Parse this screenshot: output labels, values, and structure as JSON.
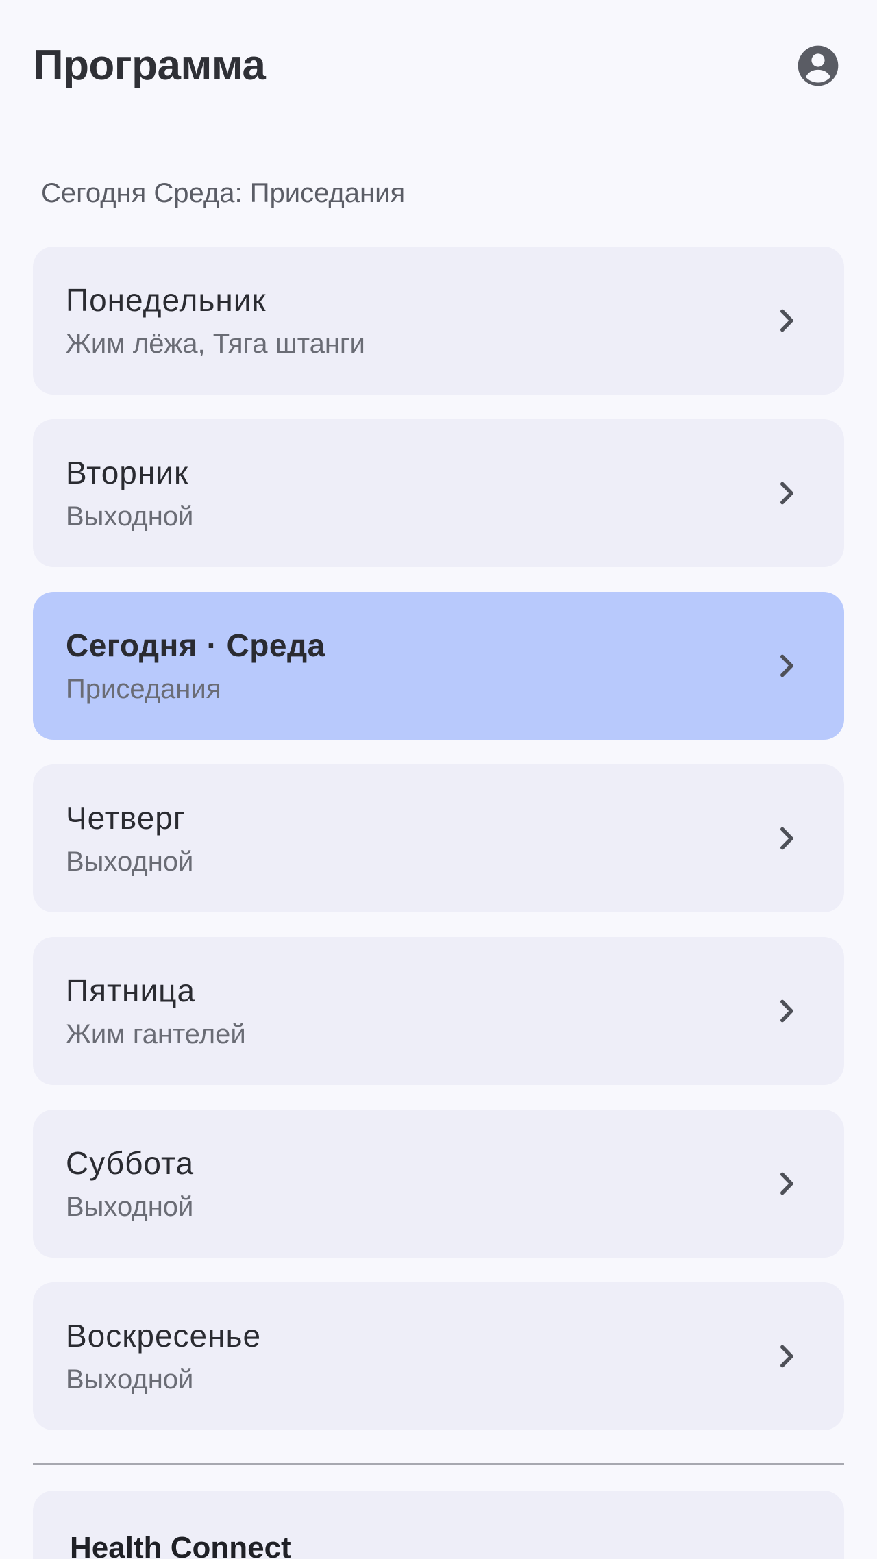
{
  "header": {
    "title": "Программа",
    "account_icon": "account-circle-icon"
  },
  "today_caption": "Сегодня Среда: Приседания",
  "days": [
    {
      "title": "Понедельник",
      "subtitle": "Жим лёжа, Тяга штанги",
      "is_today": false
    },
    {
      "title": "Вторник",
      "subtitle": "Выходной",
      "is_today": false
    },
    {
      "title": "Сегодня · Среда",
      "subtitle": "Приседания",
      "is_today": true
    },
    {
      "title": "Четверг",
      "subtitle": "Выходной",
      "is_today": false
    },
    {
      "title": "Пятница",
      "subtitle": "Жим гантелей",
      "is_today": false
    },
    {
      "title": "Суббота",
      "subtitle": "Выходной",
      "is_today": false
    },
    {
      "title": "Воскресенье",
      "subtitle": "Выходной",
      "is_today": false
    }
  ],
  "health_connect": {
    "title": "Health Connect"
  },
  "colors": {
    "background": "#f8f8fd",
    "card": "#eeeef8",
    "today_card": "#b8c9fc",
    "divider": "#a7a8b0",
    "title_text": "#2f3036",
    "secondary_text": "#6a6c75"
  }
}
